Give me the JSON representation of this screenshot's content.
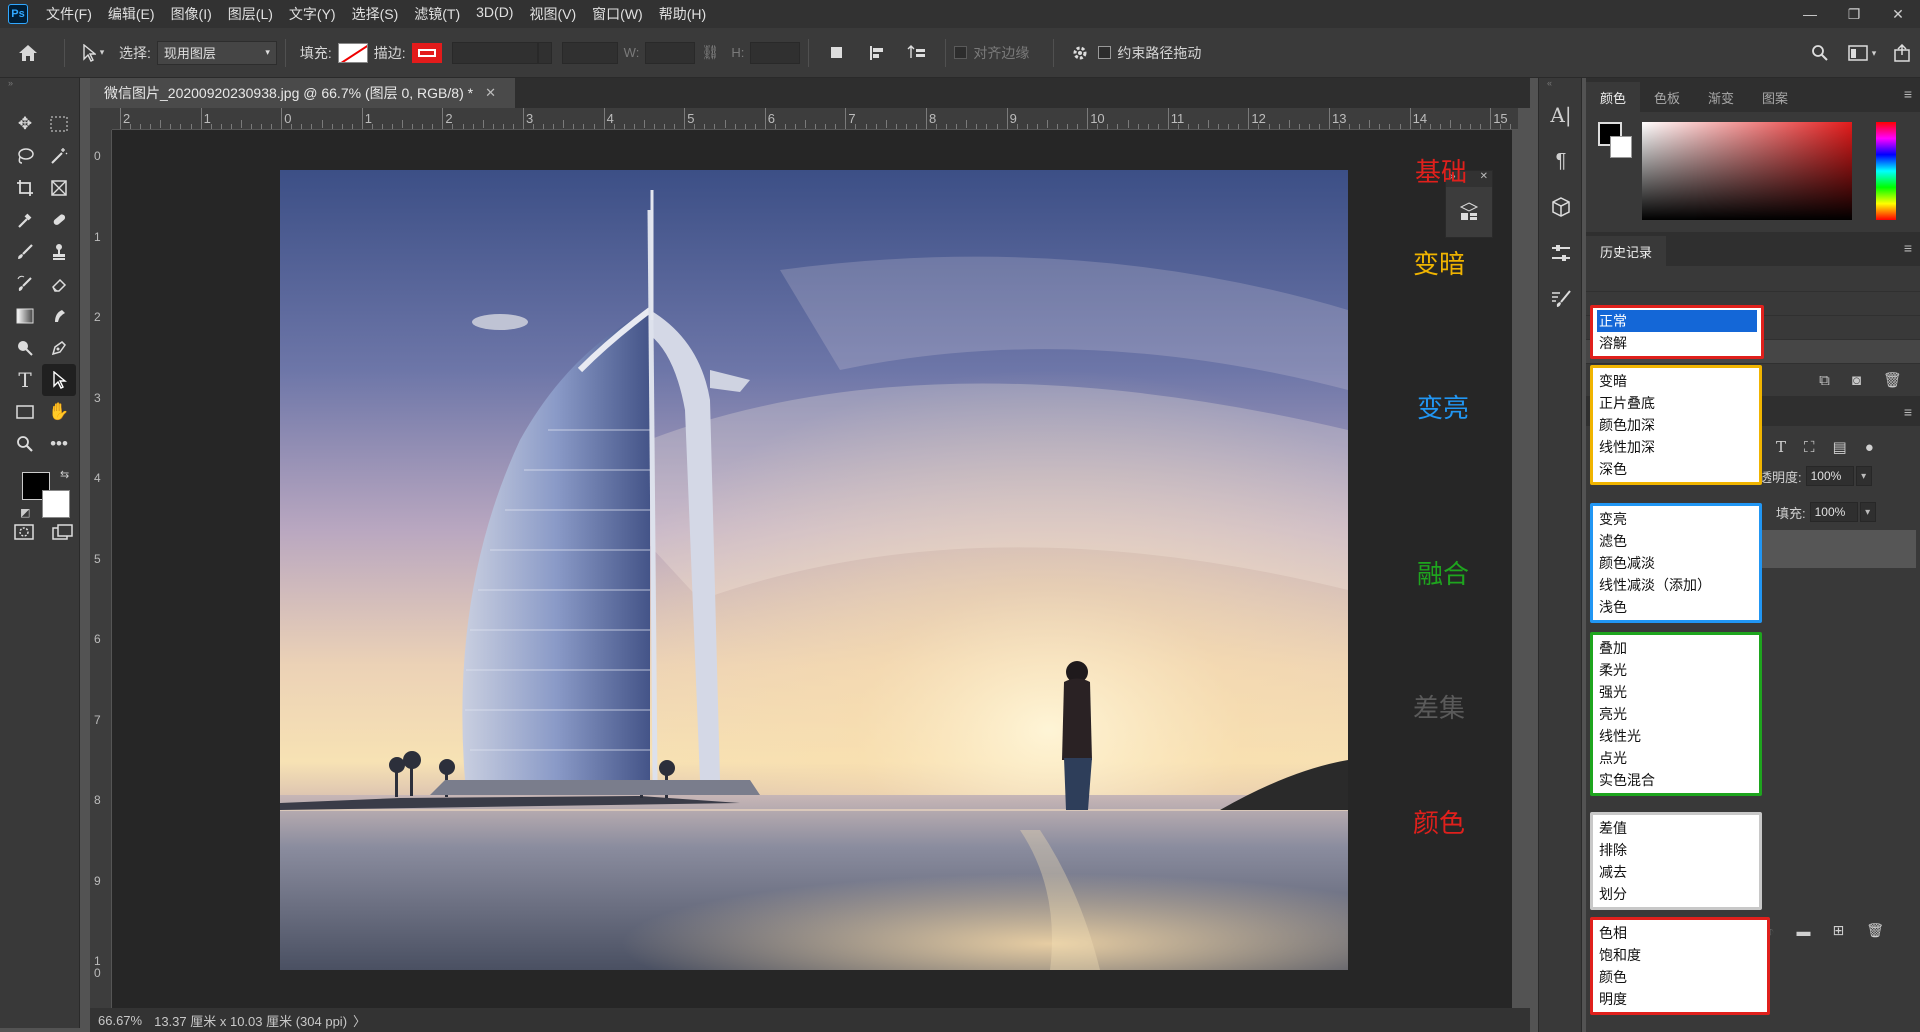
{
  "app": {
    "logo": "Ps"
  },
  "menu": [
    "文件(F)",
    "编辑(E)",
    "图像(I)",
    "图层(L)",
    "文字(Y)",
    "选择(S)",
    "滤镜(T)",
    "3D(D)",
    "视图(V)",
    "窗口(W)",
    "帮助(H)"
  ],
  "window_controls": {
    "minimize": "—",
    "restore": "❐",
    "close": "✕"
  },
  "options": {
    "select_label": "选择:",
    "select_value": "现用图层",
    "fill_label": "填充:",
    "stroke_label": "描边:",
    "w_label": "W:",
    "h_label": "H:",
    "align_edges": "对齐边缘",
    "constrain_path": "约束路径拖动"
  },
  "document": {
    "tab_title": "微信图片_20200920230938.jpg @ 66.7% (图层 0, RGB/8) *",
    "close": "✕"
  },
  "ruler": {
    "top": [
      "2",
      "1",
      "0",
      "1",
      "2",
      "3",
      "4",
      "5",
      "6",
      "7",
      "8",
      "9",
      "10",
      "11",
      "12",
      "13",
      "14",
      "15"
    ],
    "left": [
      "0",
      "1",
      "2",
      "3",
      "4",
      "5",
      "6",
      "7",
      "8",
      "9",
      "1\n0"
    ]
  },
  "side_labels": [
    {
      "text": "基础",
      "color": "#e0201c"
    },
    {
      "text": "变暗",
      "color": "#f0b400"
    },
    {
      "text": "变亮",
      "color": "#2196f3"
    },
    {
      "text": "融合",
      "color": "#1ea51e"
    },
    {
      "text": "差集",
      "color": "#5a5a5a"
    },
    {
      "text": "颜色",
      "color": "#e0201c"
    }
  ],
  "status": {
    "zoom": "66.67%",
    "info": "13.37 厘米 x 10.03 厘米 (304 ppi)",
    "arrow": "〉"
  },
  "panels": {
    "color_tabs": [
      "颜色",
      "色板",
      "渐变",
      "图案"
    ],
    "history_tab": "历史记录",
    "opacity_label": "不透明度:",
    "opacity_value": "100%",
    "fill_label": "填充:",
    "fill_value": "100%"
  },
  "blend_groups": [
    {
      "color": "#e0201c",
      "items": [
        "正常",
        "溶解"
      ],
      "selected": "正常"
    },
    {
      "color": "#f0b400",
      "items": [
        "变暗",
        "正片叠底",
        "颜色加深",
        "线性加深",
        "深色"
      ]
    },
    {
      "color": "#2196f3",
      "items": [
        "变亮",
        "滤色",
        "颜色减淡",
        "线性减淡（添加）",
        "浅色"
      ]
    },
    {
      "color": "#1ea51e",
      "items": [
        "叠加",
        "柔光",
        "强光",
        "亮光",
        "线性光",
        "点光",
        "实色混合"
      ]
    },
    {
      "color": "#c8c8c8",
      "items": [
        "差值",
        "排除",
        "减去",
        "划分"
      ]
    },
    {
      "color": "#e0201c",
      "items": [
        "色相",
        "饱和度",
        "颜色",
        "明度"
      ]
    }
  ],
  "colors": {
    "foreground": "#000000",
    "background": "#ffffff",
    "selection": "#1467d7"
  }
}
